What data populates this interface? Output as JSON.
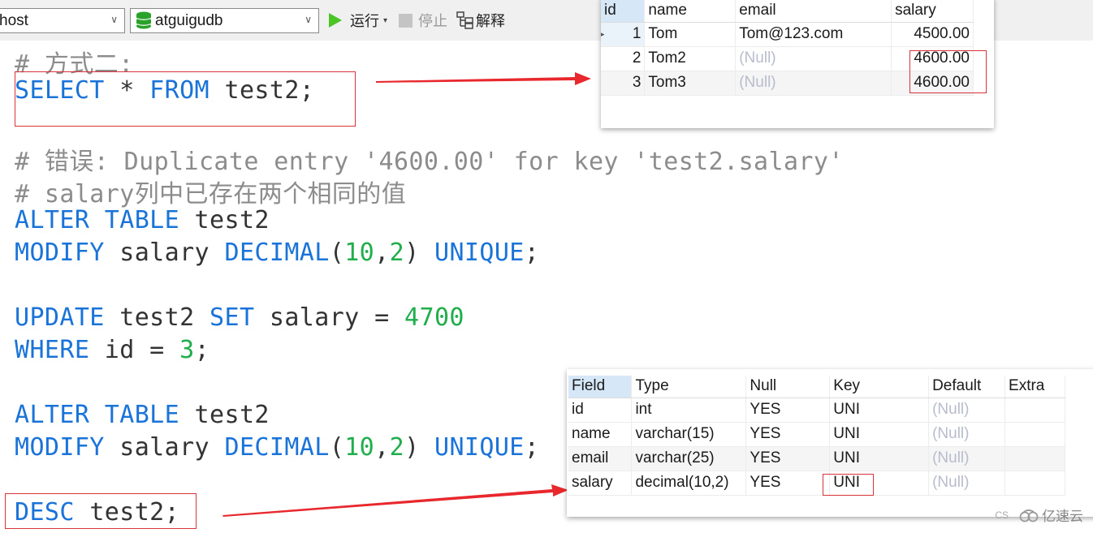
{
  "toolbar": {
    "connection_value": "host",
    "database_value": "atguigudb",
    "run_label": "运行",
    "stop_label": "停止",
    "explain_label": "解释"
  },
  "editor": {
    "lines": {
      "comment1": "# 方式二:",
      "select": {
        "kw1": "SELECT",
        "star": " * ",
        "kw2": "FROM",
        "rest": " test2;"
      },
      "comment2": "# 错误: Duplicate entry '4600.00' for key 'test2.salary'",
      "comment3": "# salary列中已存在两个相同的值",
      "alter1": {
        "kw1": "ALTER",
        "kw2": "TABLE",
        "rest": " test2"
      },
      "modify1": {
        "kw1": "MODIFY",
        "mid": " salary ",
        "kw2": "DECIMAL",
        "p1": "(",
        "n1": "10",
        "comma": ",",
        "n2": "2",
        "p2": ") ",
        "kw3": "UNIQUE",
        "end": ";"
      },
      "update": {
        "kw1": "UPDATE",
        "mid1": " test2 ",
        "kw2": "SET",
        "mid2": " salary = ",
        "n1": "4700"
      },
      "where": {
        "kw1": "WHERE",
        "mid": " id = ",
        "n1": "3",
        "end": ";"
      },
      "alter2": {
        "kw1": "ALTER",
        "kw2": "TABLE",
        "rest": " test2"
      },
      "modify2": {
        "kw1": "MODIFY",
        "mid": " salary ",
        "kw2": "DECIMAL",
        "p1": "(",
        "n1": "10",
        "comma": ",",
        "n2": "2",
        "p2": ") ",
        "kw3": "UNIQUE",
        "end": ";"
      },
      "desc": {
        "kw1": "DESC",
        "rest": " test2;"
      }
    }
  },
  "result_select": {
    "columns": [
      "id",
      "name",
      "email",
      "salary"
    ],
    "rows": [
      {
        "id": "1",
        "name": "Tom",
        "email": "Tom@123.com",
        "salary": "4500.00"
      },
      {
        "id": "2",
        "name": "Tom2",
        "email": "(Null)",
        "salary": "4600.00"
      },
      {
        "id": "3",
        "name": "Tom3",
        "email": "(Null)",
        "salary": "4600.00"
      }
    ]
  },
  "result_desc": {
    "columns": [
      "Field",
      "Type",
      "Null",
      "Key",
      "Default",
      "Extra"
    ],
    "rows": [
      {
        "field": "id",
        "type": "int",
        "null": "YES",
        "key": "UNI",
        "default": "(Null)",
        "extra": ""
      },
      {
        "field": "name",
        "type": "varchar(15)",
        "null": "YES",
        "key": "UNI",
        "default": "(Null)",
        "extra": ""
      },
      {
        "field": "email",
        "type": "varchar(25)",
        "null": "YES",
        "key": "UNI",
        "default": "(Null)",
        "extra": ""
      },
      {
        "field": "salary",
        "type": "decimal(10,2)",
        "null": "YES",
        "key": "UNI",
        "default": "(Null)",
        "extra": ""
      }
    ]
  },
  "watermark": {
    "prefix": "CS",
    "brand": "亿速云"
  },
  "colors": {
    "keyword": "#1a73d9",
    "number": "#1fae4b",
    "comment": "#8c8c8c",
    "highlight": "#d8333a",
    "arrow": "#e8282c",
    "run": "#4bc526"
  }
}
